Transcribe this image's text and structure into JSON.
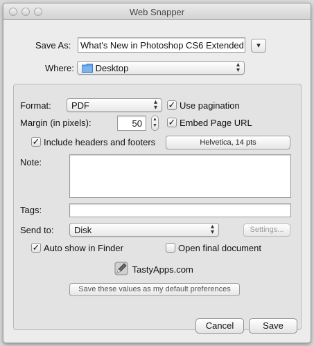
{
  "window": {
    "title": "Web Snapper"
  },
  "save_as": {
    "label": "Save As:",
    "value": "What's New in Photoshop CS6 Extended",
    "expand_glyph": "▾"
  },
  "where": {
    "label": "Where:",
    "value": "Desktop"
  },
  "format": {
    "label": "Format:",
    "value": "PDF"
  },
  "use_pagination": {
    "label": "Use pagination",
    "checked": true
  },
  "margin": {
    "label": "Margin (in pixels):",
    "value": "50"
  },
  "embed_page_url": {
    "label": "Embed Page URL",
    "checked": true
  },
  "include_headers": {
    "label": "Include headers and footers",
    "checked": true
  },
  "font_button": {
    "label": "Helvetica, 14 pts"
  },
  "note": {
    "label": "Note:",
    "value": ""
  },
  "tags": {
    "label": "Tags:",
    "value": ""
  },
  "send_to": {
    "label": "Send to:",
    "value": "Disk",
    "settings_label": "Settings..."
  },
  "auto_show": {
    "label": "Auto show in Finder",
    "checked": true
  },
  "open_final": {
    "label": "Open final document",
    "checked": false
  },
  "brand": {
    "text": "TastyApps.com",
    "icon": "pen-icon"
  },
  "defaults_button": {
    "label": "Save these values as my default preferences"
  },
  "footer": {
    "cancel_label": "Cancel",
    "save_label": "Save"
  },
  "check_glyph": "✓",
  "colors": {
    "window_bg": "#ececec",
    "panel_bg": "#e3e3e3",
    "folder_blue": "#5fa0e6"
  }
}
